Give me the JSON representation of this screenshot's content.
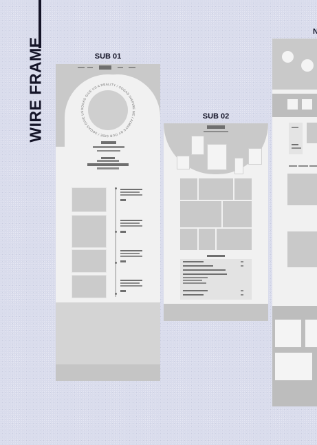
{
  "board": {
    "title": "WIRE FRAME",
    "frames": [
      {
        "label": "SUB 01"
      },
      {
        "label": "SUB 02"
      },
      {
        "label": "N"
      }
    ]
  },
  "sub01": {
    "ring_text": "SOGAS GIVE US A REALITY / SOGAS INSPIRE ME / ALWAYS BY OUR SIDE / SOGAS GIVE US A DREAM /"
  },
  "colors": {
    "background": "#d9dcec",
    "ink": "#141427",
    "wire_gray": "#c9c9c9",
    "wire_dark": "#8a8a8a",
    "frame_white": "#f1f1f1"
  }
}
